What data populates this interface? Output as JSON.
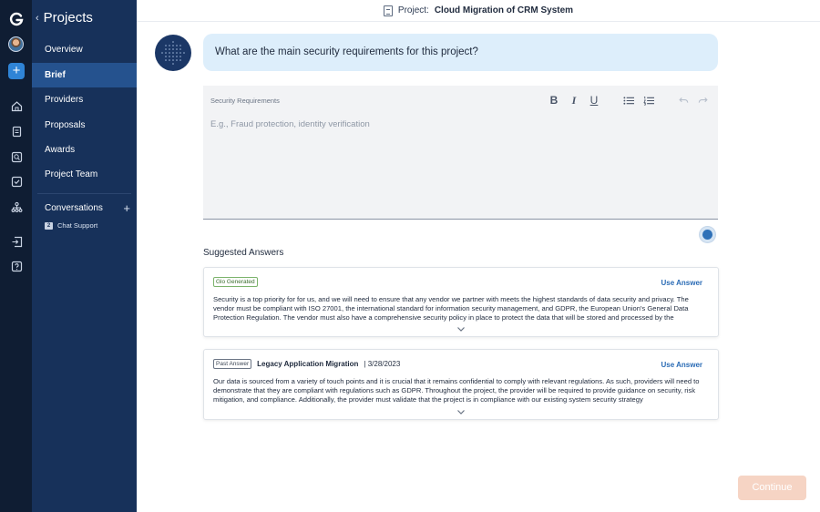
{
  "rail": {
    "icons": [
      "logo-icon",
      "avatar",
      "add-icon",
      "home-icon",
      "briefcase-icon",
      "search-icon",
      "checklist-icon",
      "org-chart-icon",
      "export-icon",
      "help-icon"
    ]
  },
  "sidebar": {
    "title": "Projects",
    "items": [
      {
        "label": "Overview"
      },
      {
        "label": "Brief"
      },
      {
        "label": "Providers"
      },
      {
        "label": "Proposals"
      },
      {
        "label": "Awards"
      },
      {
        "label": "Project Team"
      }
    ],
    "active_item": "Brief",
    "conversations_label": "Conversations",
    "chat": {
      "badge": "2",
      "label": "Chat Support"
    }
  },
  "topbar": {
    "prefix": "Project:",
    "project_name": "Cloud Migration of CRM System"
  },
  "question": {
    "text": "What are the main security requirements for this project?"
  },
  "editor": {
    "label": "Security Requirements",
    "placeholder": "E.g., Fraud protection, identity verification",
    "toolbar": {
      "bold": "B",
      "italic": "I",
      "underline": "U"
    }
  },
  "suggested": {
    "title": "Suggested Answers",
    "cards": [
      {
        "tag": "Glo Generated",
        "source": "",
        "date": "",
        "action": "Use Answer",
        "text": "Security is a top priority for for us, and we will need to ensure that any vendor we partner with meets the highest standards of data security and privacy. The vendor must be compliant with ISO 27001, the international standard for information security management, and GDPR, the European Union's General Data Protection Regulation. The vendor must also have a comprehensive security policy in place to protect the data that will be stored and processed by the"
      },
      {
        "tag": "Past Answer",
        "source": "Legacy Application Migration",
        "date": "| 3/28/2023",
        "action": "Use Answer",
        "text": "Our data is sourced from a variety of touch points and it is crucial that it remains confidential to comply with relevant regulations. As such, providers will need to demonstrate that they are compliant with regulations such as GDPR. Throughout the project, the provider will be required to provide guidance on security, risk mitigation, and compliance. Additionally, the provider must validate that the project is in compliance with our existing system security strategy"
      }
    ]
  },
  "continue_label": "Continue",
  "colors": {
    "rail": "#0f1d33",
    "sidebar": "#17315a",
    "active": "#25528e",
    "bubble": "#ddeefb",
    "link": "#2a6bb5",
    "continue_disabled": "#f6d4c4"
  }
}
